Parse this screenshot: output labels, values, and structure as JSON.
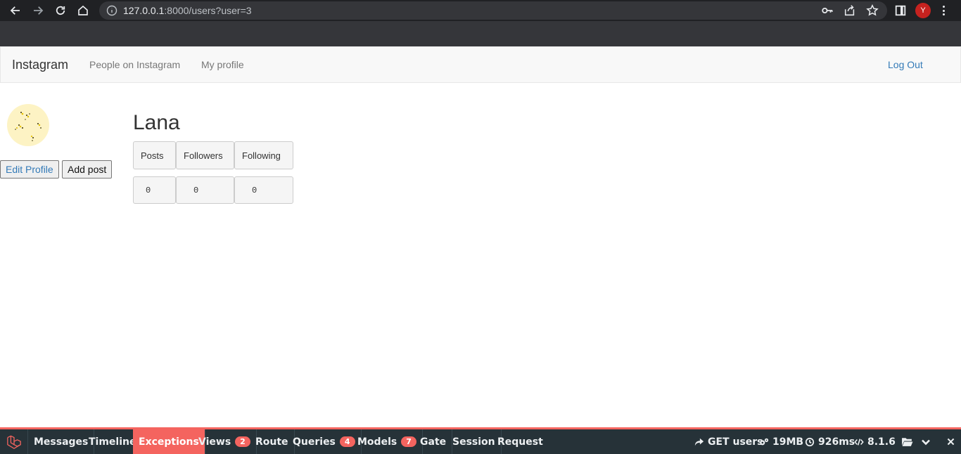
{
  "browser": {
    "url_host": "127.0.0.1",
    "url_rest": ":8000/users?user=3",
    "profile_initial": "Y"
  },
  "navbar": {
    "brand": "Instagram",
    "links": [
      "People on Instagram",
      "My profile"
    ],
    "logout": "Log Out"
  },
  "profile": {
    "username": "Lana",
    "edit_button": "Edit Profile",
    "add_post_button": "Add post",
    "stats_headers": [
      "Posts",
      "Followers",
      "Following"
    ],
    "stats_values": [
      "0",
      "0",
      "0"
    ]
  },
  "debugbar": {
    "tabs": [
      {
        "label": "Messages"
      },
      {
        "label": "Timeline"
      },
      {
        "label": "Exceptions"
      },
      {
        "label": "Views",
        "badge": "2"
      },
      {
        "label": "Route"
      },
      {
        "label": "Queries",
        "badge": "4"
      },
      {
        "label": "Models",
        "badge": "7"
      },
      {
        "label": "Gate"
      },
      {
        "label": "Session"
      },
      {
        "label": "Request"
      }
    ],
    "active_tab": "Exceptions",
    "route": "GET users",
    "memory": "19MB",
    "time": "926ms",
    "php_version": "8.1.6",
    "accent_color": "#f4645f"
  }
}
